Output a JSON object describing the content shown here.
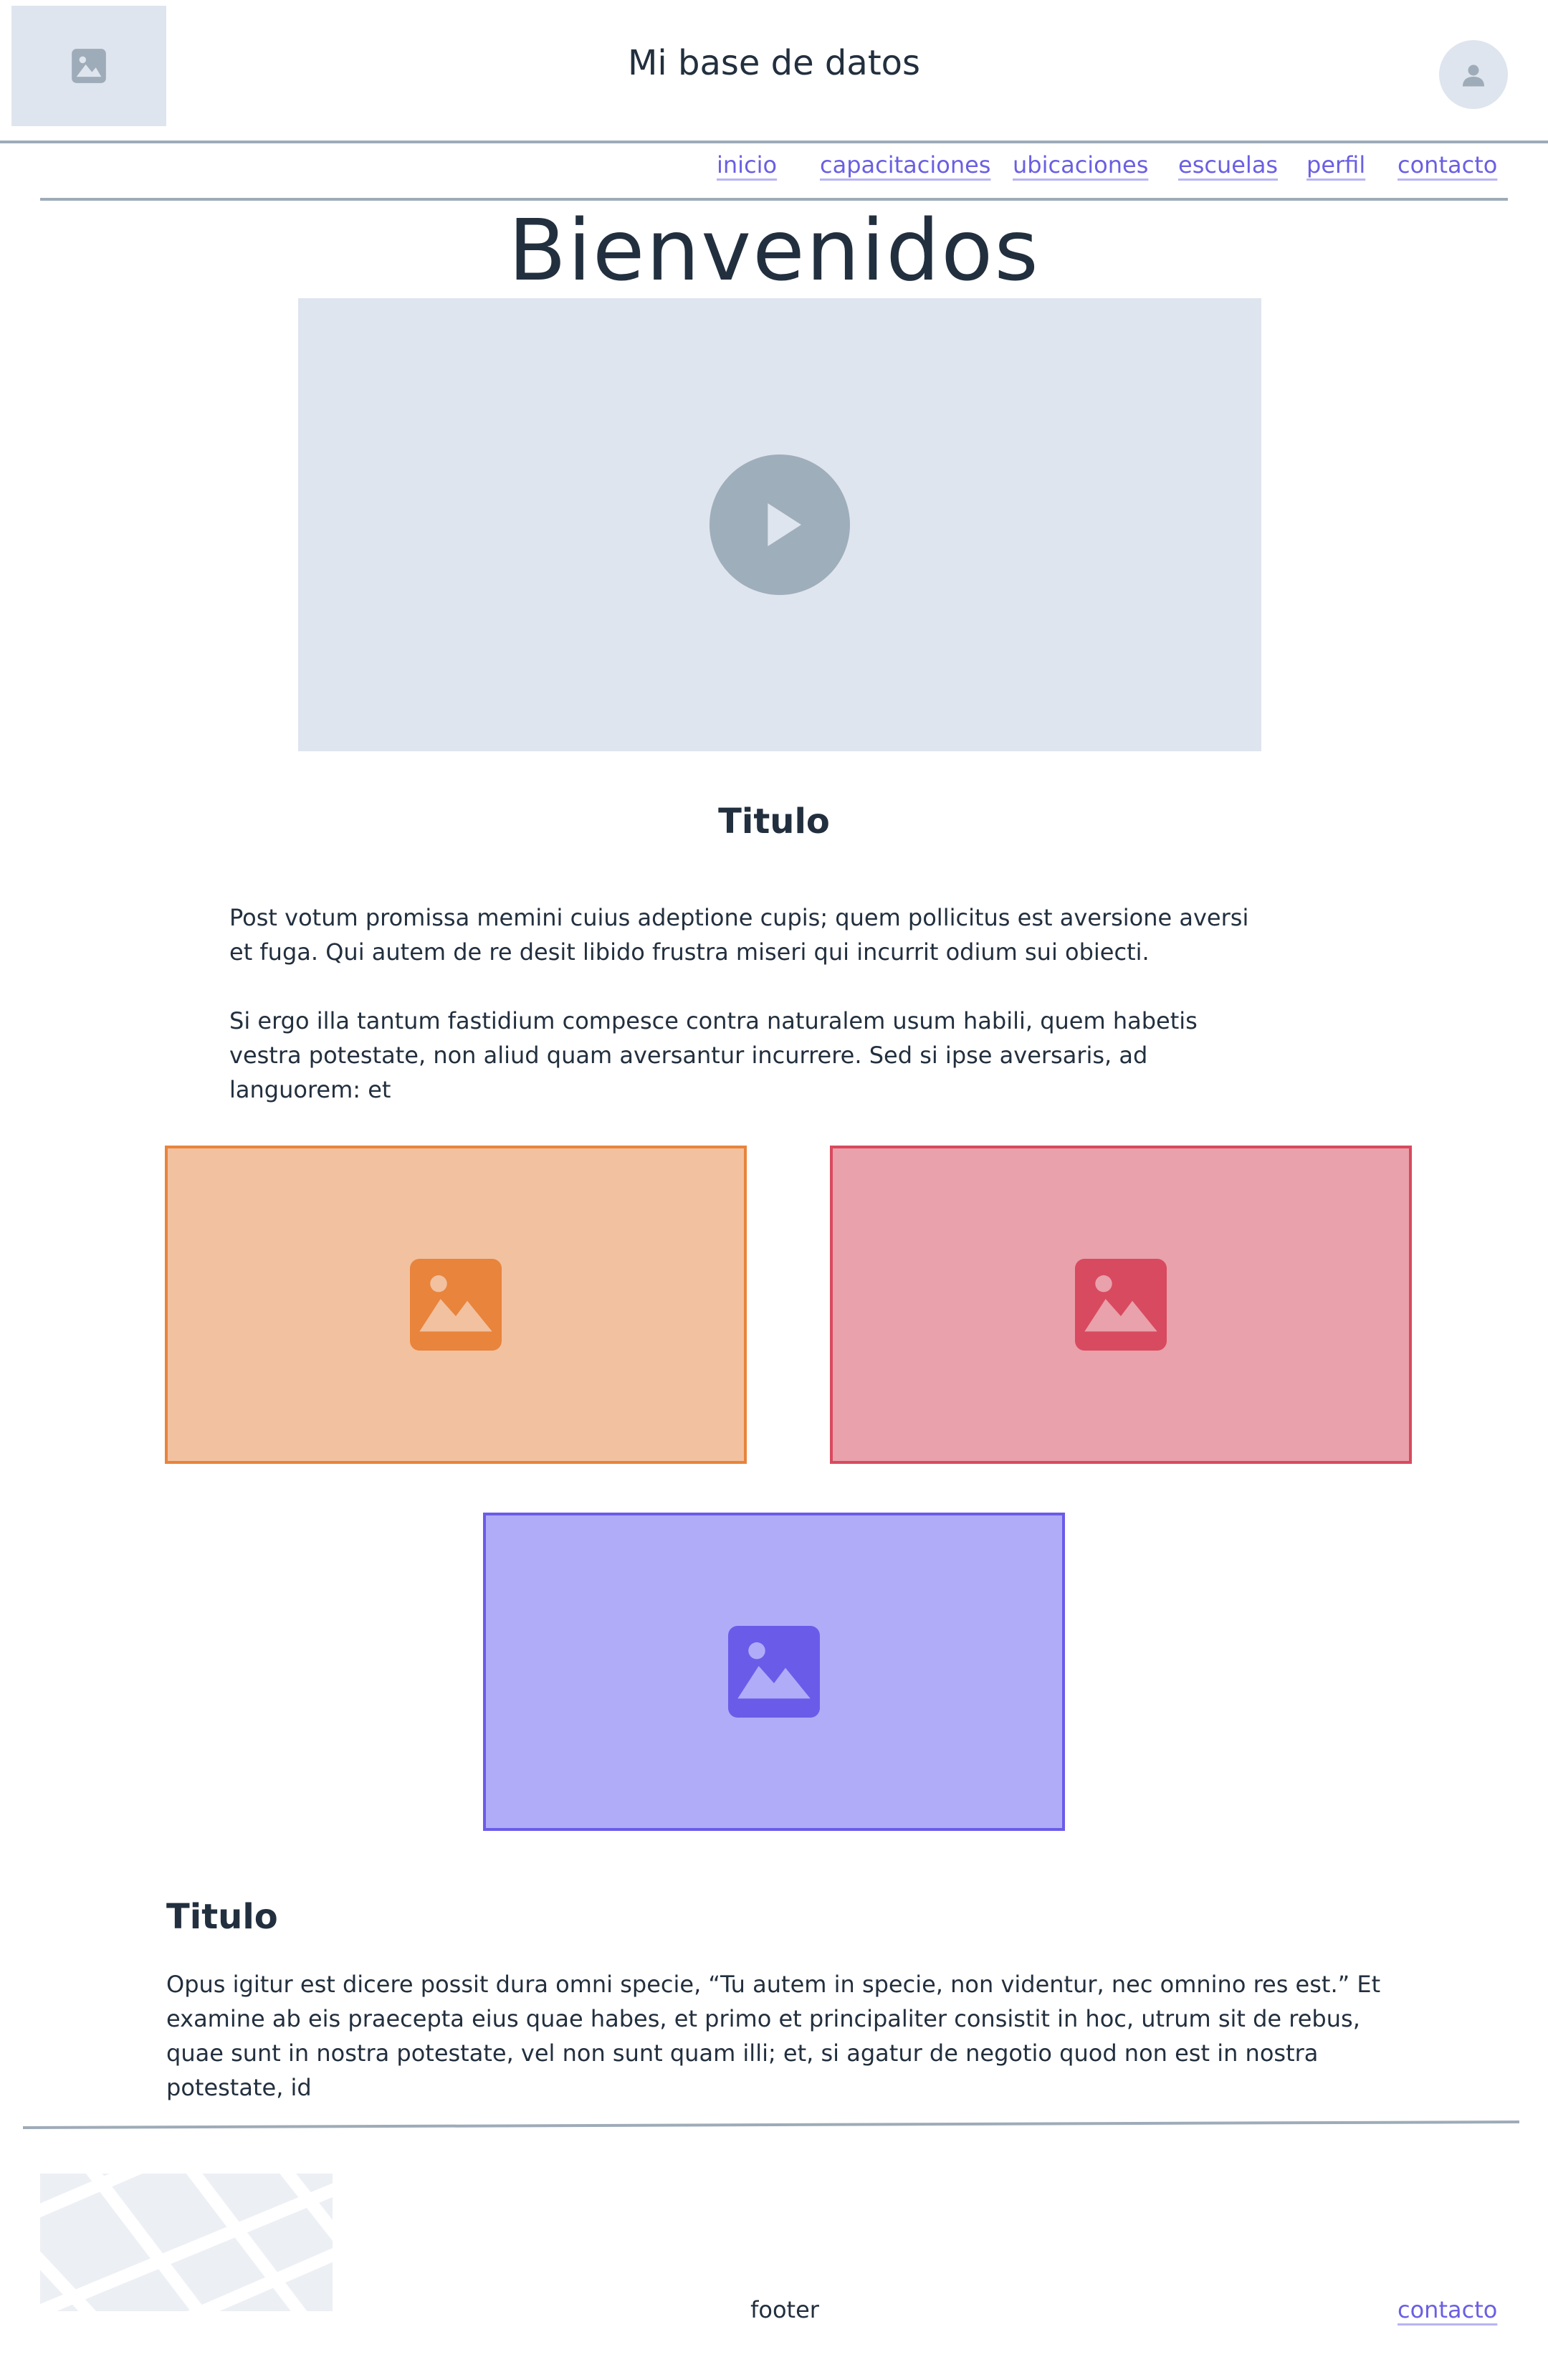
{
  "header": {
    "title": "Mi base de datos",
    "logo_icon": "image-icon",
    "avatar_icon": "user-icon"
  },
  "nav": {
    "items": [
      {
        "label": "inicio"
      },
      {
        "label": "capacitaciones"
      },
      {
        "label": "ubicaciones"
      },
      {
        "label": "escuelas"
      },
      {
        "label": "perfil"
      },
      {
        "label": "contacto"
      }
    ]
  },
  "main": {
    "welcome": "Bienvenidos",
    "video": {
      "icon": "play-icon"
    },
    "section1": {
      "title": "Titulo",
      "paragraphs": [
        "Post votum promissa memini cuius adeptione cupis; quem pollicitus est aversione aversi et fuga. Qui autem de re desit libido frustra miseri qui incurrit odium sui obiecti.",
        "Si ergo illa tantum fastidium compesce contra naturalem usum habili, quem habetis vestra potestate, non aliud quam aversantur incurrere. Sed si ipse aversaris, ad languorem: et"
      ]
    },
    "cards": [
      {
        "icon": "image-icon",
        "color": "#e8843c",
        "fill": "#f2c1a0"
      },
      {
        "icon": "image-icon",
        "color": "#d84a5f",
        "fill": "#e9a1ab"
      },
      {
        "icon": "image-icon",
        "color": "#6a5ce9",
        "fill": "#b1acf8"
      }
    ],
    "section2": {
      "title": "Titulo",
      "paragraph": "Opus igitur est dicere possit dura omni specie, “Tu autem in specie, non videntur, nec omnino res est.” Et examine ab eis praecepta eius quae habes, et primo et principaliter consistit in hoc, utrum sit de rebus, quae sunt in nostra potestate, vel non sunt quam illi; et, si agatur de negotio quod non est in nostra potestate, id"
    }
  },
  "footer": {
    "label": "footer",
    "link": "contacto",
    "map_icon": "map-icon"
  },
  "colors": {
    "accent": "#6a5fe3",
    "placeholder": "#dfe5ee",
    "text": "#222f3e",
    "divider": "#9eabb8"
  }
}
